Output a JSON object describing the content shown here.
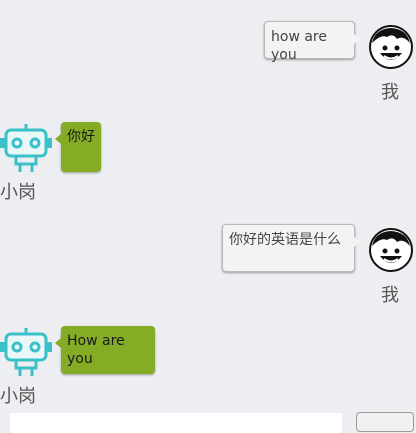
{
  "messages": [
    {
      "sender": "me",
      "name": "我",
      "text": "how are you",
      "avatar_icon": "smiley-face-icon"
    },
    {
      "sender": "bot",
      "name": "小岗",
      "text": "你好",
      "avatar_icon": "robot-icon"
    },
    {
      "sender": "me",
      "name": "我",
      "text": "你好的英语是什么",
      "avatar_icon": "smiley-face-icon"
    },
    {
      "sender": "bot",
      "name": "小岗",
      "text": "How are you",
      "avatar_icon": "robot-icon"
    }
  ],
  "colors": {
    "background": "#eceef1",
    "bot_bubble": "#84ac25",
    "user_bubble": "#f3f3f3",
    "robot_icon": "#3cc0c8"
  },
  "composer": {
    "input_value": ""
  }
}
